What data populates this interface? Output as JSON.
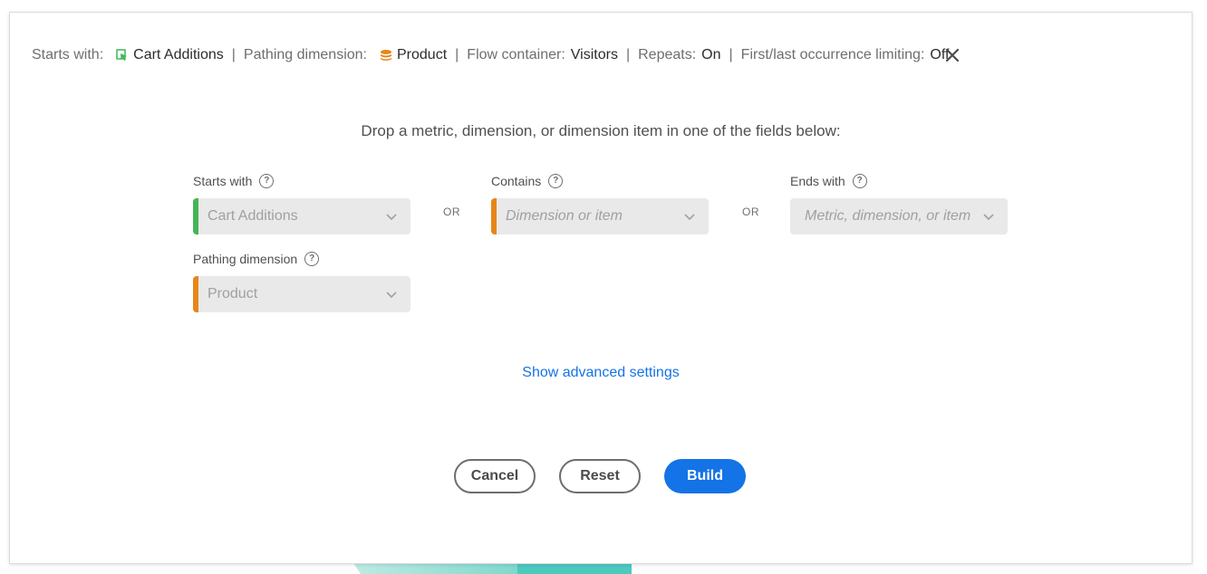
{
  "summary": {
    "starts_with_label": "Starts with:",
    "starts_with_value": "Cart Additions",
    "pathing_label": "Pathing dimension:",
    "pathing_value": "Product",
    "flow_label": "Flow container:",
    "flow_value": "Visitors",
    "repeats_label": "Repeats:",
    "repeats_value": "On",
    "limiting_label": "First/last occurrence limiting:",
    "limiting_value": "Off",
    "separator": "|"
  },
  "icons": {
    "metric": "metric-icon",
    "dimension": "dimension-icon",
    "close": "close-icon",
    "help": "help-icon",
    "chevron": "chevron-down-icon"
  },
  "instruction": "Drop a metric, dimension, or dimension item in one of the fields below:",
  "fields": {
    "starts_with": {
      "label": "Starts with",
      "value": "Cart Additions"
    },
    "contains": {
      "label": "Contains",
      "placeholder": "Dimension or item"
    },
    "ends_with": {
      "label": "Ends with",
      "placeholder": "Metric, dimension, or item"
    },
    "pathing_dimension": {
      "label": "Pathing dimension",
      "value": "Product"
    },
    "or_label": "OR"
  },
  "advanced_link": "Show advanced settings",
  "buttons": {
    "cancel": "Cancel",
    "reset": "Reset",
    "build": "Build"
  },
  "colors": {
    "metric_accent": "#44b556",
    "dimension_accent": "#e68619",
    "primary": "#1473e6"
  }
}
